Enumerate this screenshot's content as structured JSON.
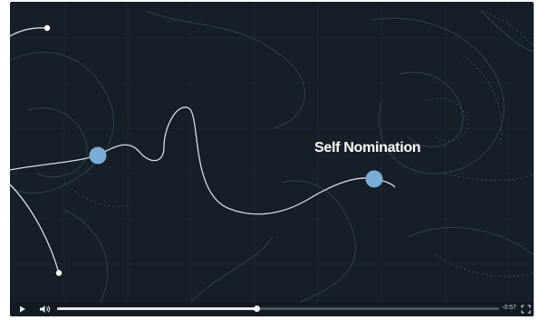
{
  "video": {
    "caption": "Self Nomination",
    "accent_color": "#79add7"
  },
  "controls": {
    "play_icon": "play-icon",
    "volume_icon": "volume-icon",
    "fullscreen_icon": "fullscreen-icon",
    "progress_fraction": 0.45,
    "time_remaining": "-0:57"
  }
}
